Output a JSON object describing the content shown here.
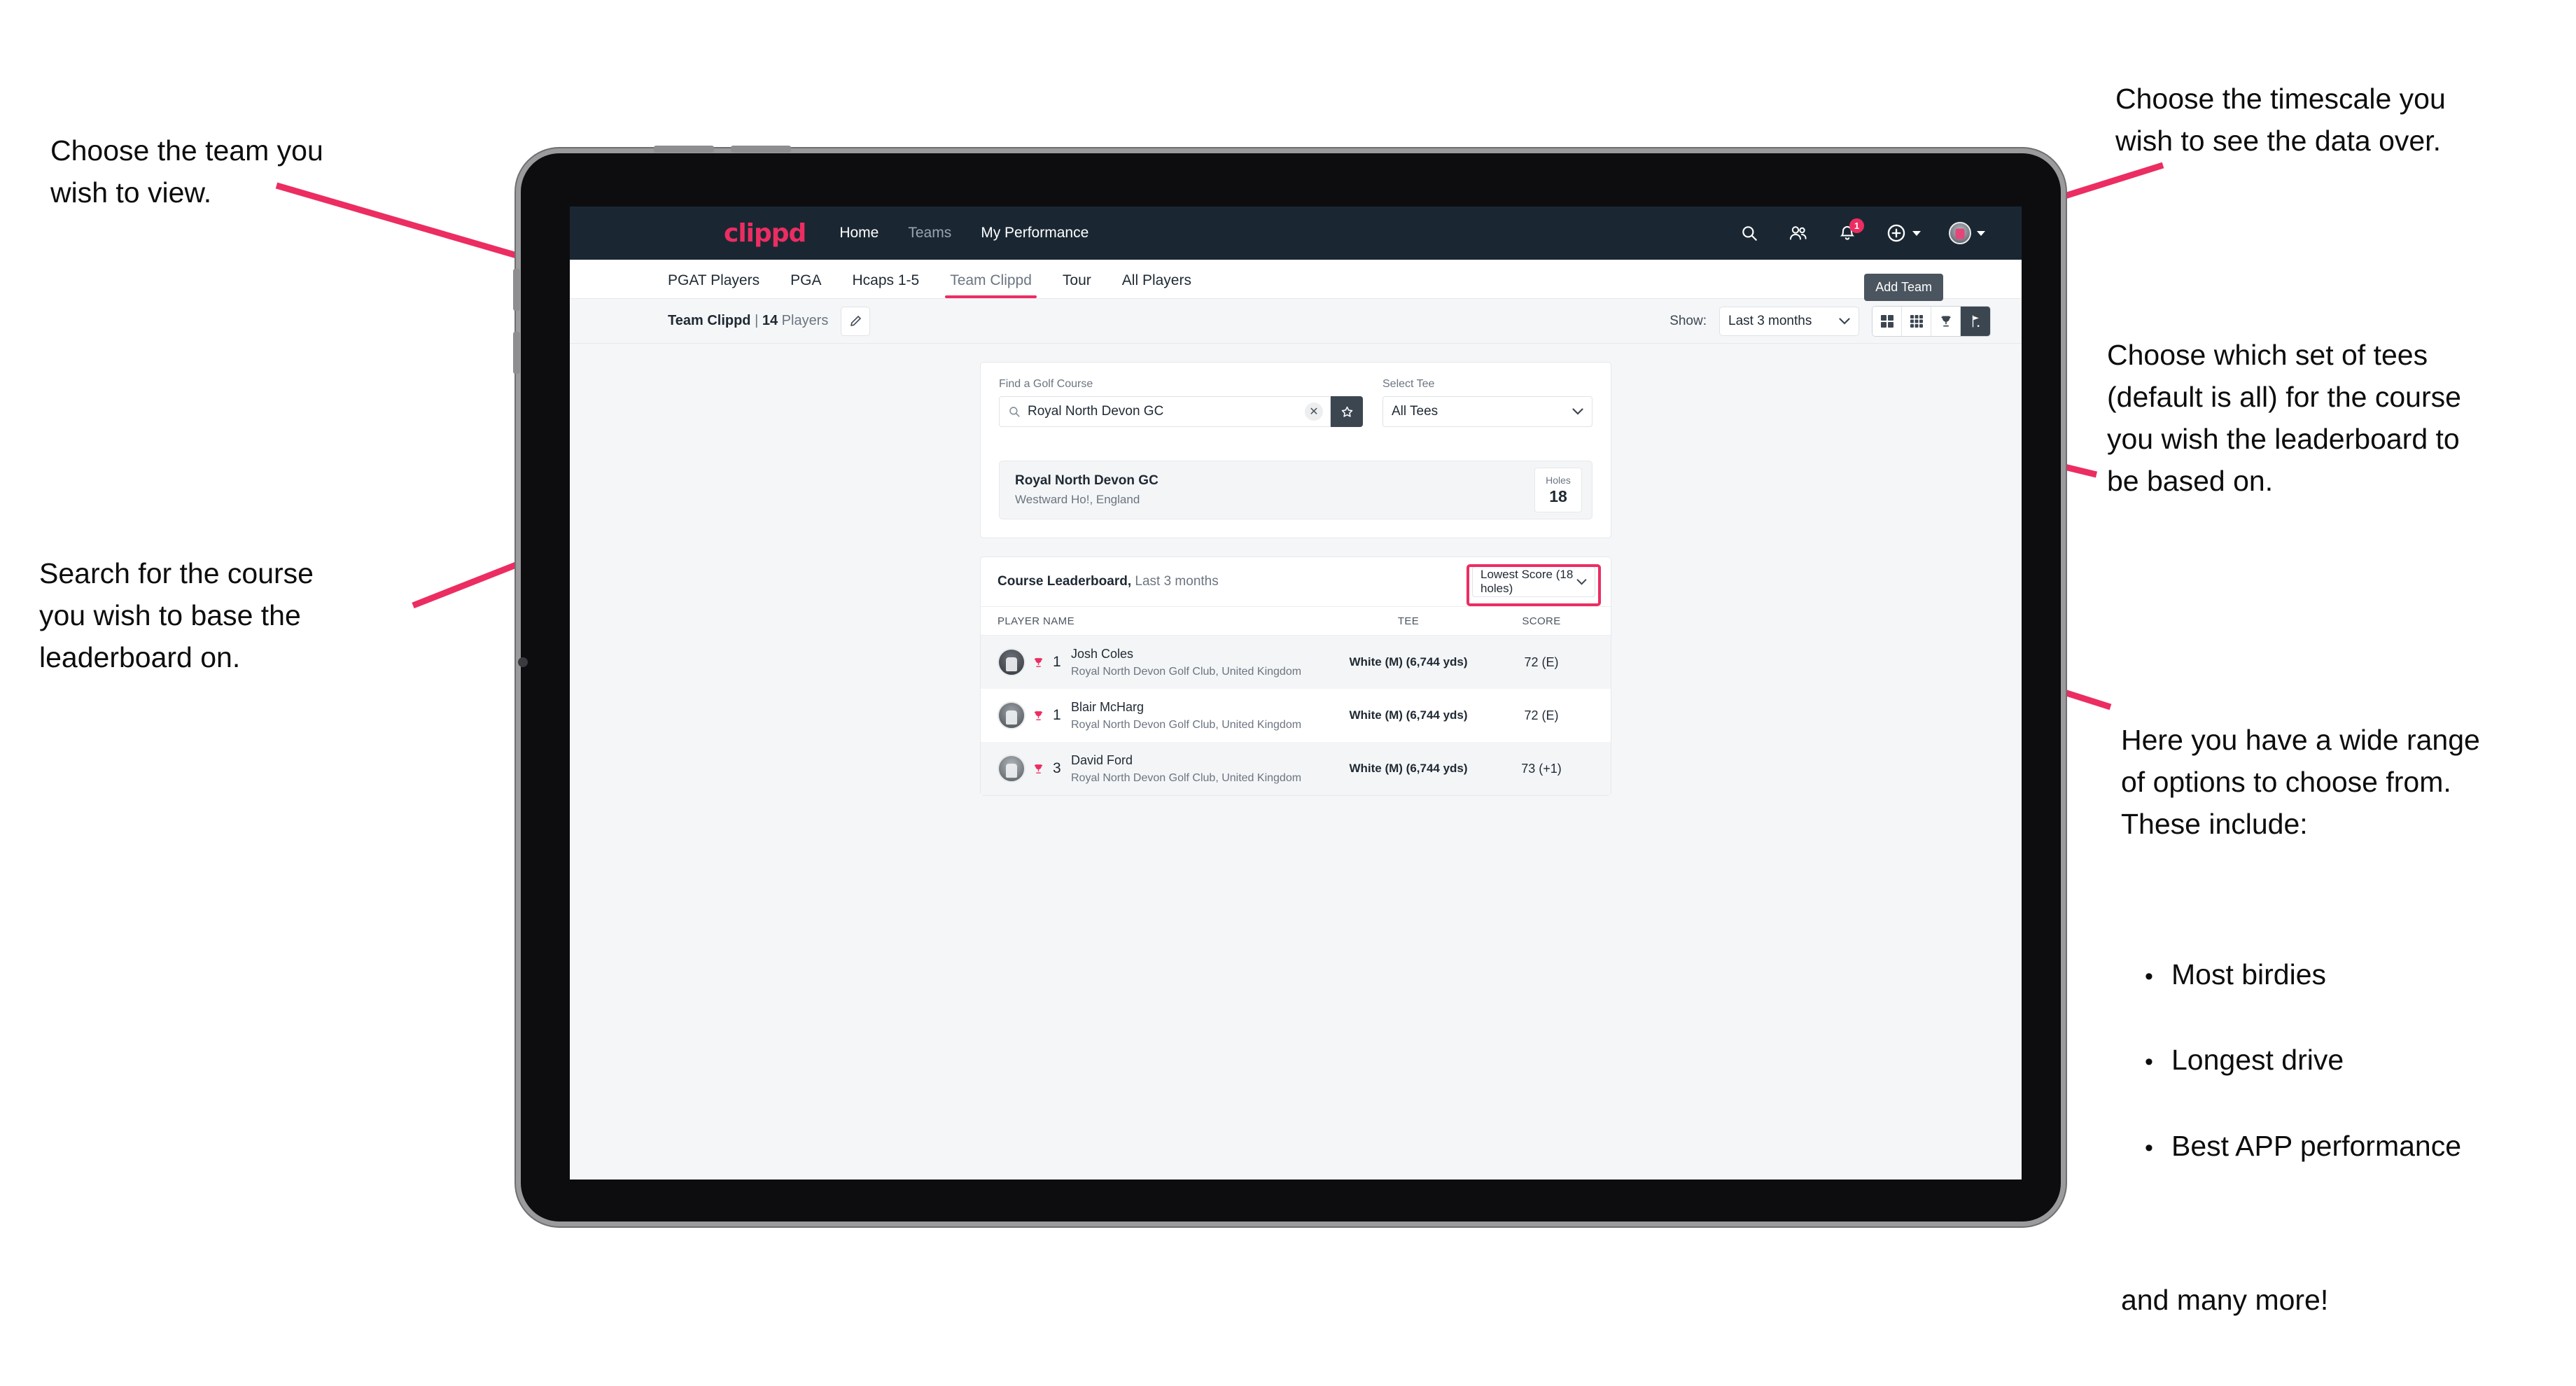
{
  "annotations": {
    "team": "Choose the team you\nwish to view.",
    "search": "Search for the course\nyou wish to base the\nleaderboard on.",
    "timescale": "Choose the timescale you\nwish to see the data over.",
    "tees": "Choose which set of tees\n(default is all) for the course\nyou wish the leaderboard to\nbe based on.",
    "options_intro": "Here you have a wide range\nof options to choose from.\nThese include:",
    "options_list": [
      "Most birdies",
      "Longest drive",
      "Best APP performance"
    ],
    "options_outro": "and many more!"
  },
  "navbar": {
    "brand": "clippd",
    "links": [
      {
        "label": "Home",
        "state": "active"
      },
      {
        "label": "Teams",
        "state": "dim"
      },
      {
        "label": "My Performance",
        "state": "active"
      }
    ],
    "icons": {
      "search": "search-icon",
      "people": "people-icon",
      "notifications": "bell-icon",
      "notification_count": "1",
      "add": "plus-circle-icon",
      "avatar": "avatar-icon"
    }
  },
  "tabs": [
    {
      "label": "PGAT Players",
      "active": false,
      "dim": false
    },
    {
      "label": "PGA",
      "active": false,
      "dim": false
    },
    {
      "label": "Hcaps 1-5",
      "active": false,
      "dim": false
    },
    {
      "label": "Team Clippd",
      "active": true,
      "dim": false
    },
    {
      "label": "Tour",
      "active": false,
      "dim": false
    },
    {
      "label": "All Players",
      "active": false,
      "dim": false
    }
  ],
  "toolbar": {
    "team_name": "Team Clippd",
    "separator": "|",
    "player_count": "14",
    "players_word": "Players",
    "edit_icon": "pencil-icon",
    "show_label": "Show:",
    "period_value": "Last 3 months",
    "add_team_tooltip": "Add Team",
    "view_buttons": [
      {
        "name": "grid-2x2-icon",
        "active": false
      },
      {
        "name": "grid-3x3-icon",
        "active": false
      },
      {
        "name": "trophy-icon",
        "active": false
      },
      {
        "name": "golf-flag-icon",
        "active": true
      }
    ]
  },
  "search_panel": {
    "course_label": "Find a Golf Course",
    "course_value": "Royal North Devon GC",
    "course_placeholder": "Find a Golf Course",
    "clear_icon": "close-icon",
    "star_icon": "star-icon",
    "tee_label": "Select Tee",
    "tee_value": "All Tees"
  },
  "course_card": {
    "name": "Royal North Devon GC",
    "location": "Westward Ho!, England",
    "holes_label": "Holes",
    "holes_value": "18"
  },
  "leaderboard": {
    "title": "Course Leaderboard,",
    "subtitle": "Last 3 months",
    "metric_value": "Lowest Score (18 holes)",
    "columns": [
      "PLAYER NAME",
      "TEE",
      "SCORE"
    ],
    "rows": [
      {
        "rank": "1",
        "name": "Josh Coles",
        "club": "Royal North Devon Golf Club, United Kingdom",
        "tee": "White (M) (6,744 yds)",
        "score": "72 (E)"
      },
      {
        "rank": "1",
        "name": "Blair McHarg",
        "club": "Royal North Devon Golf Club, United Kingdom",
        "tee": "White (M) (6,744 yds)",
        "score": "72 (E)"
      },
      {
        "rank": "3",
        "name": "David Ford",
        "club": "Royal North Devon Golf Club, United Kingdom",
        "tee": "White (M) (6,744 yds)",
        "score": "73 (+1)"
      }
    ]
  },
  "colors": {
    "accent": "#ec2d62",
    "navbar": "#1a2733",
    "dark_control": "#3c4651",
    "page_bg": "#f5f6f8"
  }
}
